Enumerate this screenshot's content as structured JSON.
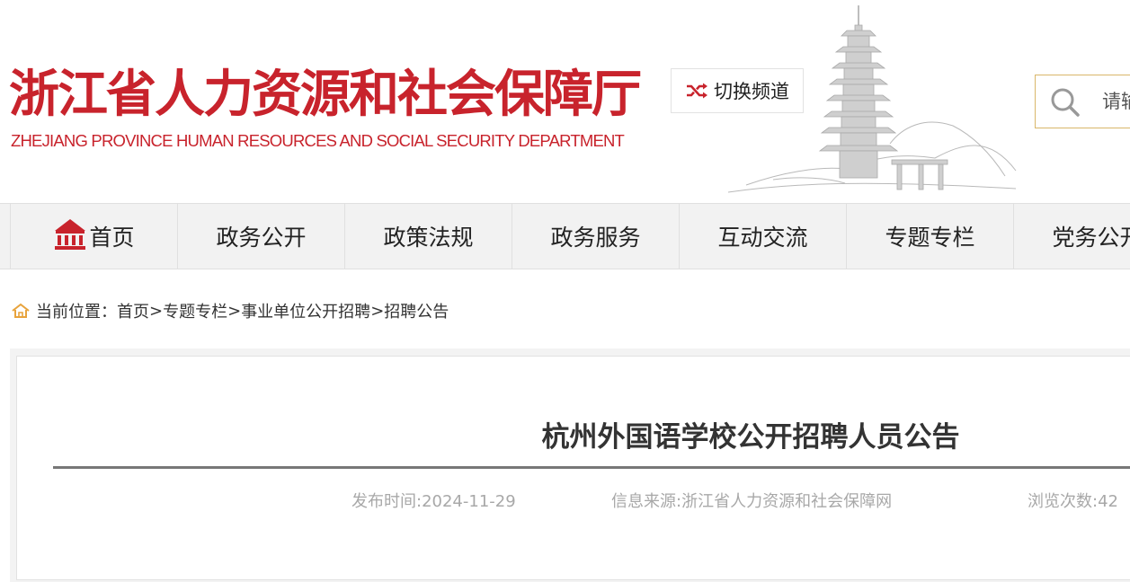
{
  "header": {
    "title": "浙江省人力资源和社会保障厅",
    "subtitle": "ZHEJIANG PROVINCE HUMAN RESOURCES AND SOCIAL SECURITY DEPARTMENT",
    "switch_channel_label": "切换频道",
    "search_placeholder": "请输",
    "brand_color": "#c8232c"
  },
  "nav": {
    "items": [
      {
        "label": "首页",
        "icon": "home-icon"
      },
      {
        "label": "政务公开"
      },
      {
        "label": "政策法规"
      },
      {
        "label": "政务服务"
      },
      {
        "label": "互动交流"
      },
      {
        "label": "专题专栏"
      },
      {
        "label": "党务公开"
      }
    ]
  },
  "breadcrumb": {
    "prefix": "当前位置：",
    "items": [
      "首页",
      "专题专栏",
      "事业单位公开招聘",
      "招聘公告"
    ],
    "separator": ">"
  },
  "article": {
    "title": "杭州外国语学校公开招聘人员公告",
    "publish_time": "发布时间:2024-11-29",
    "source": "信息来源:浙江省人力资源和社会保障网",
    "views": "浏览次数:42"
  }
}
